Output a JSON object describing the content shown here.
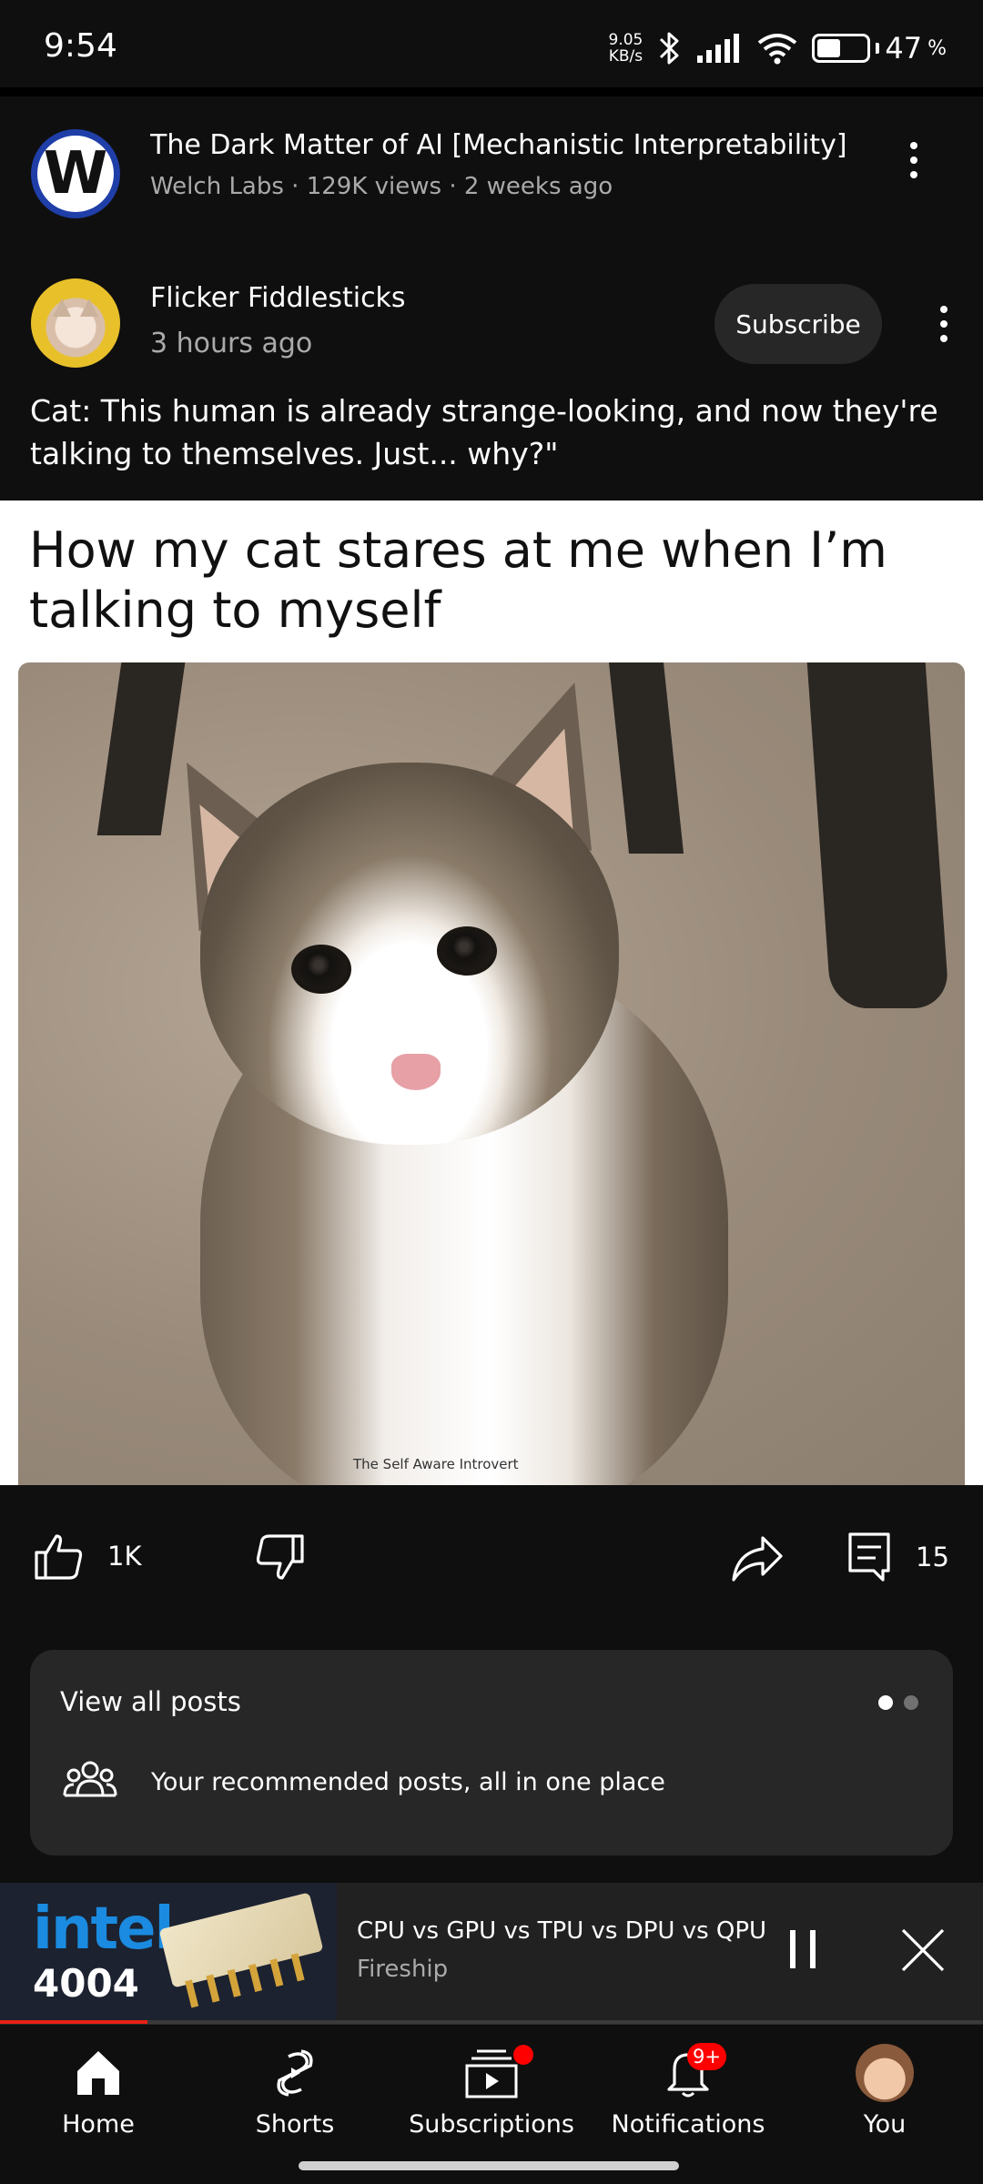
{
  "status_bar": {
    "time": "9:54",
    "net_speed_value": "9.05",
    "net_speed_unit": "KB/s",
    "battery_percent": "47",
    "battery_suffix": "%",
    "battery_level": 0.47,
    "icons": [
      "bluetooth-icon",
      "signal-icon",
      "wifi-icon",
      "battery-icon"
    ]
  },
  "video_row": {
    "avatar_letter": "W",
    "title": "The Dark Matter of AI [Mechanistic Interpretability]",
    "meta": "Welch Labs · 129K views · 2 weeks ago"
  },
  "post": {
    "channel_name": "Flicker Fiddlesticks",
    "time": "3 hours ago",
    "subscribe_label": "Subscribe",
    "text": "Cat: This human is already strange-looking, and now they're talking to themselves. Just... why?\"",
    "image_caption": "How my cat stares at me when I’m talking to myself",
    "image_watermark": "The Self Aware Introvert",
    "likes": "1K",
    "comments": "15"
  },
  "posts_card": {
    "title": "View all posts",
    "subtitle": "Your recommended posts, all in one place",
    "page_count": 2,
    "active_page": 1
  },
  "mini_player": {
    "thumb_brand": "intel.",
    "thumb_number": "4004",
    "title": "CPU vs GPU vs TPU vs DPU vs QPU",
    "channel": "Fireship",
    "progress": 0.15
  },
  "bottom_nav": {
    "items": [
      {
        "label": "Home",
        "icon": "home-icon"
      },
      {
        "label": "Shorts",
        "icon": "shorts-icon"
      },
      {
        "label": "Subscriptions",
        "icon": "subscriptions-icon"
      },
      {
        "label": "Notifications",
        "icon": "bell-icon"
      },
      {
        "label": "You",
        "icon": "avatar"
      }
    ],
    "notifications_badge": "9+"
  },
  "colors": {
    "background": "#0f0f0f",
    "card": "#272727",
    "accent_red": "#ff0000",
    "muted_text": "#aaaaaa"
  }
}
